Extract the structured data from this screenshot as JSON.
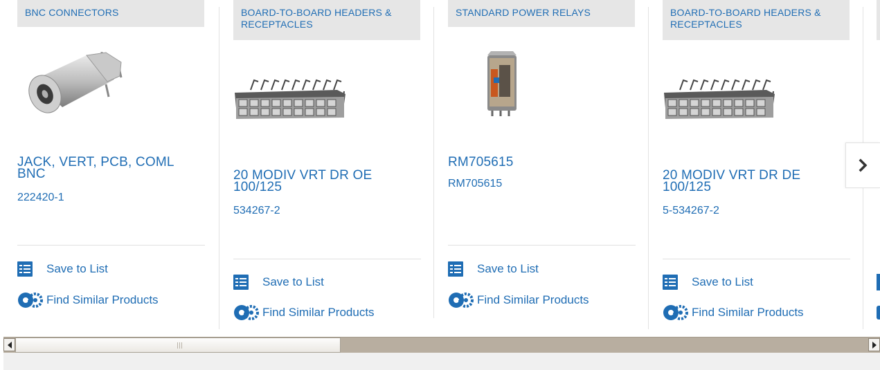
{
  "products": [
    {
      "category": "BNC CONNECTORS",
      "title": "JACK, VERT, PCB, COML BNC",
      "part_number": "222420-1",
      "image_icon": "bnc-connector-image"
    },
    {
      "category": "BOARD-TO-BOARD HEADERS & RECEPTACLES",
      "title": "20 MODIV VRT DR OE 100/125",
      "part_number": "534267-2",
      "image_icon": "header-receptacle-image"
    },
    {
      "category": "STANDARD POWER RELAYS",
      "title": "RM705615",
      "part_number": "RM705615",
      "image_icon": "power-relay-image"
    },
    {
      "category": "BOARD-TO-BOARD HEADERS & RECEPTACLES",
      "title": "20 MODIV VRT DR DE 100/125",
      "part_number": "5-534267-2",
      "image_icon": "header-receptacle-image"
    }
  ],
  "actions": {
    "save_label": "Save to List",
    "similar_label": "Find Similar Products"
  },
  "carousel": {
    "next_icon": "chevron-right-icon"
  },
  "scrollbar": {
    "left_icon": "scroll-left-icon",
    "right_icon": "scroll-right-icon"
  },
  "colors": {
    "accent": "#1f6db4",
    "category_bg": "#e6e6e6",
    "scroll_track": "#b8aea0"
  }
}
